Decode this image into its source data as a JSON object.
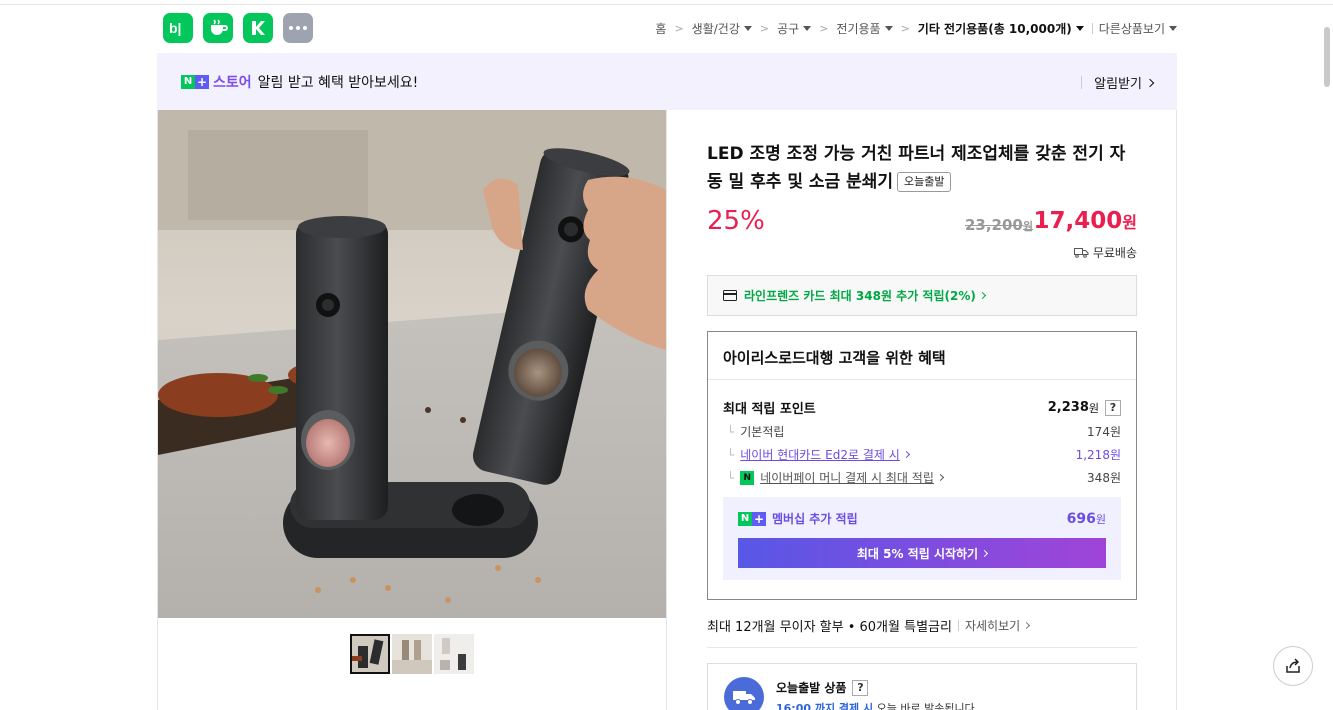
{
  "top_icons": [
    {
      "name": "blog",
      "glyph": "b|",
      "color": "#03c75a"
    },
    {
      "name": "cafe",
      "color": "#03c75a"
    },
    {
      "name": "kin",
      "color": "#03c75a"
    },
    {
      "name": "more",
      "color": "#9ea3b0"
    }
  ],
  "breadcrumb": {
    "home": "홈",
    "items": [
      "생활/건강",
      "공구",
      "전기용품"
    ],
    "current": "기타 전기용품(총 10,000개)",
    "other": "다른상품보기"
  },
  "banner": {
    "n": "N",
    "plus": "+",
    "store": "스토어",
    "text": "알림 받고 혜택 받아보세요!",
    "action": "알림받기"
  },
  "product": {
    "title": "LED 조명 조정 가능 거친 파트너 제조업체를 갖춘 전기 자동 밀 후추 및 소금 분쇄기",
    "badge": "오늘출발",
    "discount": "25%",
    "original_price": "23,200",
    "original_unit": "원",
    "sale_price": "17,400",
    "sale_unit": "원",
    "shipping": "무료배송"
  },
  "card_promo": "라인프렌즈 카드 최대 348원 추가 적립(2%)",
  "benefit": {
    "title": "아이리스로드대행 고객을 위한 혜택",
    "max_points_label": "최대 적립 포인트",
    "max_points_value": "2,238",
    "max_points_unit": "원",
    "help": "?",
    "rows": [
      {
        "label": "기본적립",
        "value": "174원"
      },
      {
        "label": "네이버 현대카드 Ed2로 결제 시",
        "value": "1,218원"
      },
      {
        "label": "네이버페이 머니 결제 시 최대 적립",
        "value": "348원"
      }
    ],
    "npay_icon": "N",
    "membership_label": "멤버십 추가 적립",
    "membership_value": "696",
    "membership_unit": "원",
    "membership_button": "최대 5% 적립 시작하기"
  },
  "installment": {
    "text": "최대 12개월 무이자 할부 • 60개월 특별금리",
    "more": "자세히보기"
  },
  "today": {
    "title": "오늘출발 상품",
    "help": "?",
    "time": "16:00 까지 결제 시",
    "sub": "오늘 바로 발송됩니다"
  },
  "colors": {
    "accent_red": "#e9204f",
    "naver_green": "#03c75a",
    "purple": "#6b4ce6"
  }
}
